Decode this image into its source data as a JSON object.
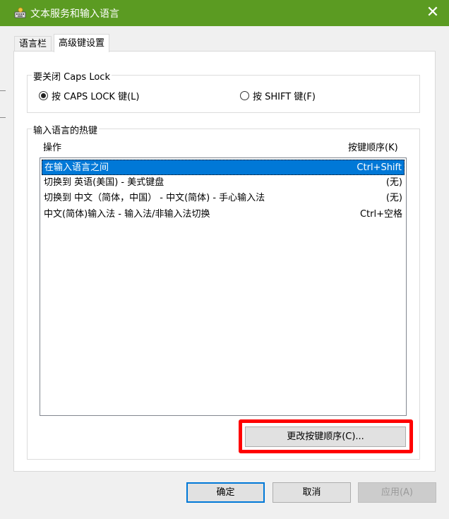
{
  "window": {
    "title": "文本服务和输入语言",
    "close_symbol": "✕",
    "titlebar_color": "#5b9b22",
    "icon": "keyboard-icon"
  },
  "tabs": [
    {
      "label": "语言栏",
      "active": false
    },
    {
      "label": "高级键设置",
      "active": true
    }
  ],
  "caps_lock_group": {
    "title": "要关闭 Caps Lock",
    "options": [
      {
        "label": "按 CAPS LOCK 键(L)",
        "checked": true
      },
      {
        "label": "按 SHIFT 键(F)",
        "checked": false
      }
    ]
  },
  "hotkeys_group": {
    "title": "输入语言的热键",
    "col_action": "操作",
    "col_keys": "按键顺序(K)",
    "rows": [
      {
        "action": "在输入语言之间",
        "keys": "Ctrl+Shift",
        "selected": true
      },
      {
        "action": "切换到 英语(美国) - 美式键盘",
        "keys": "(无)",
        "selected": false
      },
      {
        "action": "切换到 中文（简体，中国） - 中文(简体) - 手心输入法",
        "keys": "(无)",
        "selected": false
      },
      {
        "action": "中文(简体)输入法 - 输入法/非输入法切换",
        "keys": "Ctrl+空格",
        "selected": false
      }
    ],
    "change_button": "更改按键顺序(C)...",
    "highlight_color": "#ff0000"
  },
  "footer": {
    "ok": "确定",
    "cancel": "取消",
    "apply": "应用(A)"
  },
  "colors": {
    "selection": "#0078d7",
    "accent": "#5b9b22"
  }
}
